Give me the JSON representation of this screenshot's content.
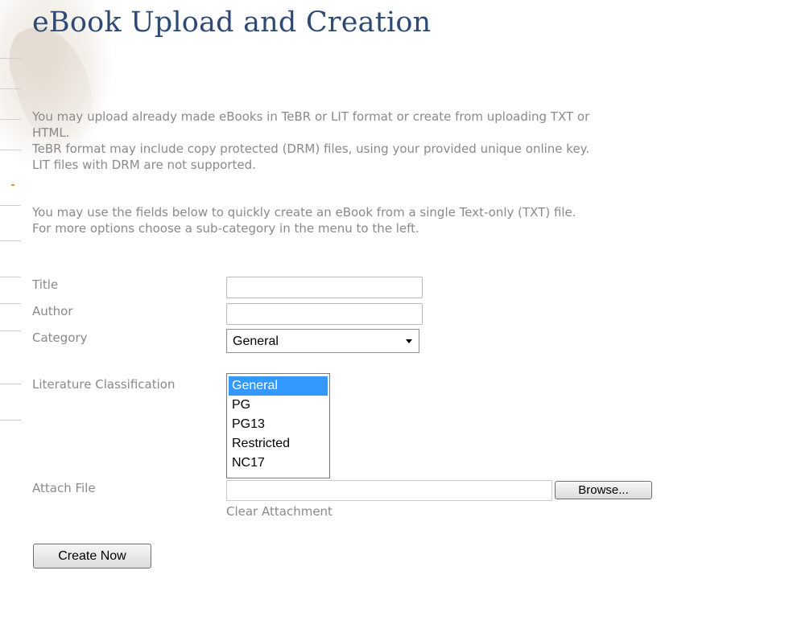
{
  "page": {
    "title": "eBook Upload and Creation",
    "intro_lines": [
      "You may upload already made eBooks in TeBR or LIT format or create from uploading TXT or",
      "HTML.",
      "TeBR format may include copy protected (DRM) files, using your provided unique online key.",
      "LIT files with DRM are not supported."
    ],
    "info_lines": [
      "You may use the fields below to quickly create an eBook from a single Text-only (TXT) file.",
      "For more options choose a sub-category in the menu to the left."
    ]
  },
  "form": {
    "title_label": "Title",
    "title_value": "",
    "author_label": "Author",
    "author_value": "",
    "category_label": "Category",
    "category_value": "General",
    "classification_label": "Literature Classification",
    "classification_options": [
      "General",
      "PG",
      "PG13",
      "Restricted",
      "NC17"
    ],
    "classification_selected": "General",
    "attach_label": "Attach File",
    "attach_value": "",
    "browse_label": "Browse...",
    "clear_attachment_label": "Clear Attachment",
    "create_button_label": "Create Now"
  },
  "colors": {
    "heading": "#2e4a74",
    "body_text": "#8a8a8a",
    "selection": "#3399ff"
  }
}
